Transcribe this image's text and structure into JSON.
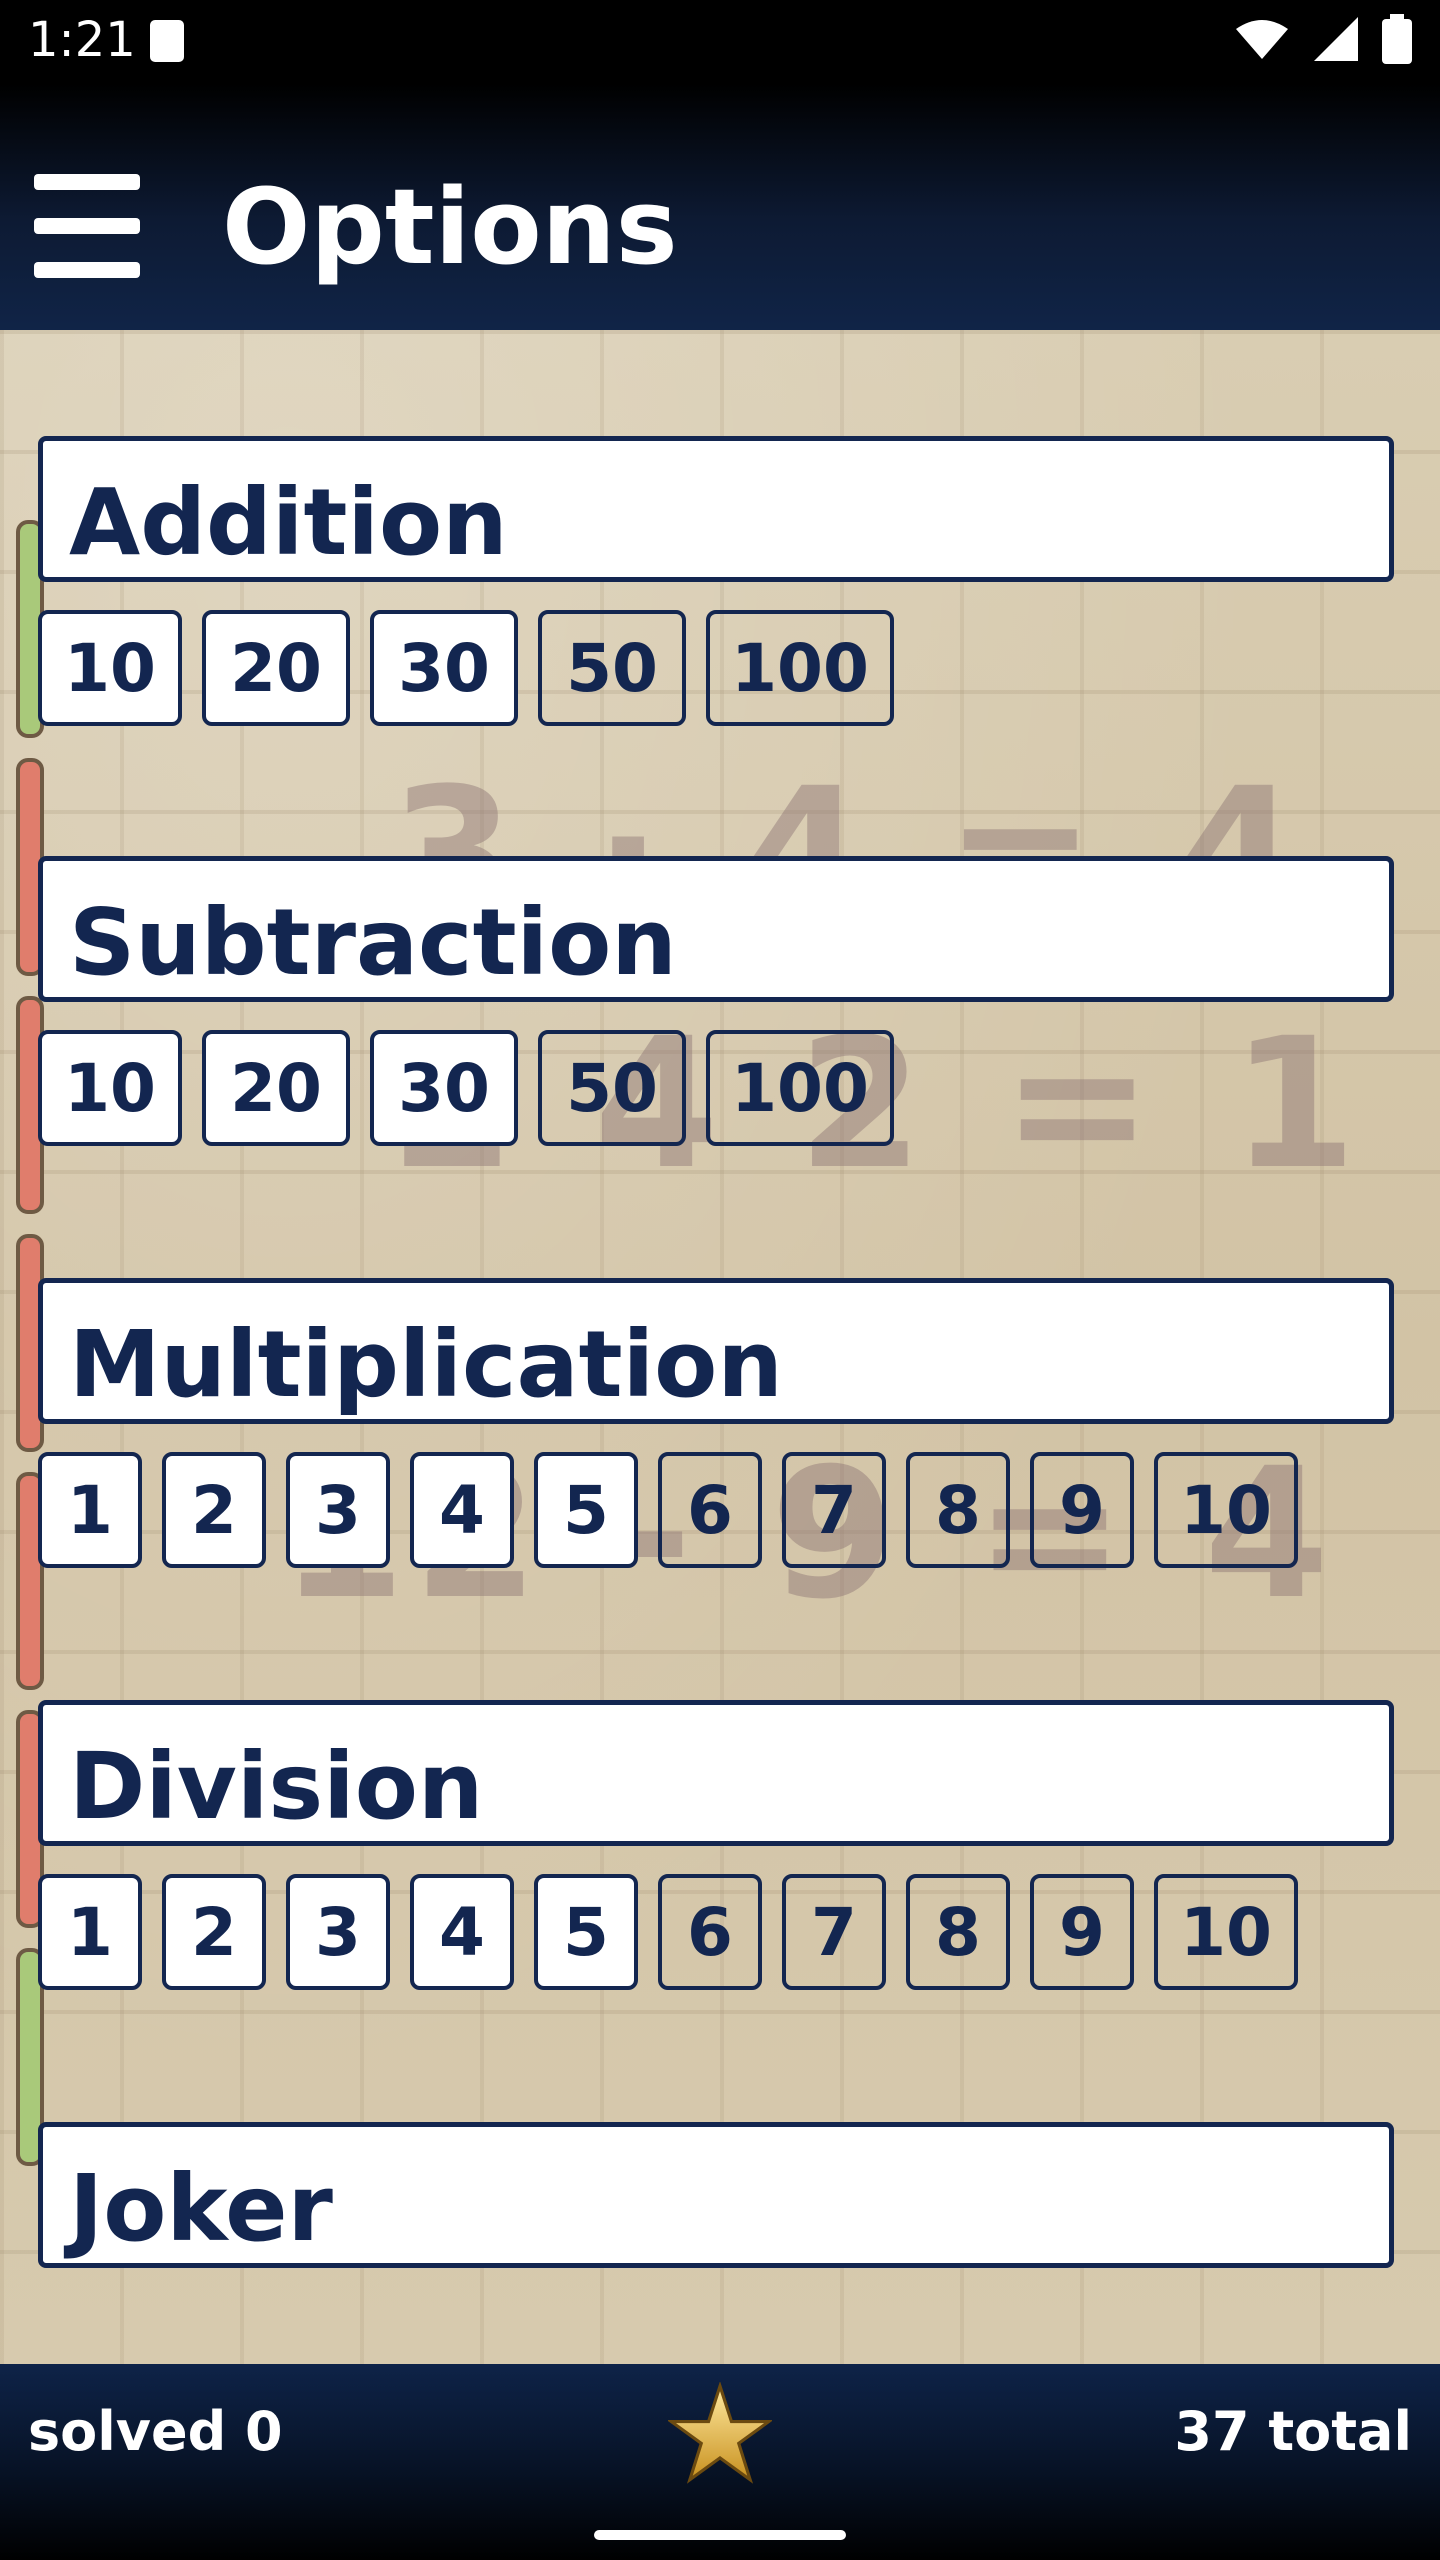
{
  "status_bar": {
    "time": "1:21"
  },
  "app_bar": {
    "title": "Options"
  },
  "sections": [
    {
      "title": "Addition",
      "options": [
        {
          "label": "10",
          "selected": true
        },
        {
          "label": "20",
          "selected": true
        },
        {
          "label": "30",
          "selected": true
        },
        {
          "label": "50",
          "selected": false
        },
        {
          "label": "100",
          "selected": false
        }
      ]
    },
    {
      "title": "Subtraction",
      "options": [
        {
          "label": "10",
          "selected": true
        },
        {
          "label": "20",
          "selected": true
        },
        {
          "label": "30",
          "selected": true
        },
        {
          "label": "50",
          "selected": false
        },
        {
          "label": "100",
          "selected": false
        }
      ]
    },
    {
      "title": "Multiplication",
      "options": [
        {
          "label": "1",
          "selected": true
        },
        {
          "label": "2",
          "selected": true
        },
        {
          "label": "3",
          "selected": true
        },
        {
          "label": "4",
          "selected": true
        },
        {
          "label": "5",
          "selected": true
        },
        {
          "label": "6",
          "selected": false
        },
        {
          "label": "7",
          "selected": false
        },
        {
          "label": "8",
          "selected": false
        },
        {
          "label": "9",
          "selected": false
        },
        {
          "label": "10",
          "selected": false
        }
      ]
    },
    {
      "title": "Division",
      "options": [
        {
          "label": "1",
          "selected": true
        },
        {
          "label": "2",
          "selected": true
        },
        {
          "label": "3",
          "selected": true
        },
        {
          "label": "4",
          "selected": true
        },
        {
          "label": "5",
          "selected": true
        },
        {
          "label": "6",
          "selected": false
        },
        {
          "label": "7",
          "selected": false
        },
        {
          "label": "8",
          "selected": false
        },
        {
          "label": "9",
          "selected": false
        },
        {
          "label": "10",
          "selected": false
        }
      ]
    },
    {
      "title": "Joker",
      "options": []
    }
  ],
  "footer": {
    "solved": "solved 0",
    "total": "37 total",
    "icon": "star-icon"
  },
  "colors": {
    "primary_navy": "#132650",
    "bar_green": "#a9c97a",
    "bar_red": "#e07d6c"
  }
}
